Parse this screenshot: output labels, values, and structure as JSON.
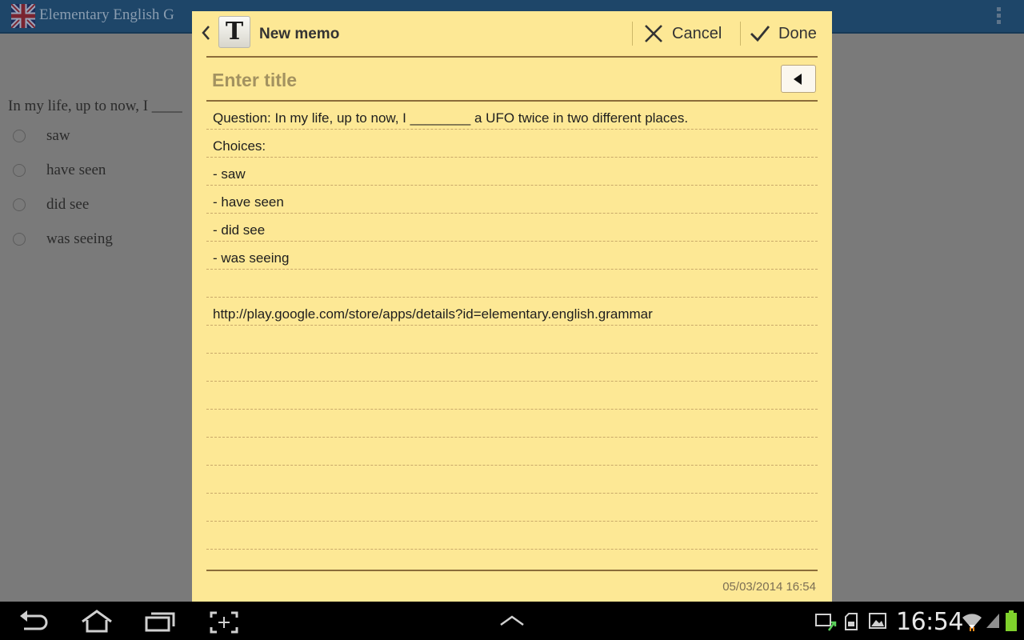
{
  "background_app": {
    "title": "Elementary English G",
    "question": "In my life, up to now, I ____",
    "choices": [
      {
        "label": "saw"
      },
      {
        "label": "have seen"
      },
      {
        "label": "did see"
      },
      {
        "label": "was seeing"
      }
    ]
  },
  "memo": {
    "header": {
      "title": "New memo",
      "app_icon": "text-memo-icon",
      "cancel_label": "Cancel",
      "done_label": "Done"
    },
    "title_field": {
      "placeholder": "Enter title",
      "value": ""
    },
    "lines": [
      "Question: In my life, up to now, I ________ a UFO twice in two different places.",
      "Choices:",
      "- saw",
      "- have seen",
      "- did see",
      "- was seeing",
      "",
      "http://play.google.com/store/apps/details?id=elementary.english.grammar",
      "",
      "",
      "",
      "",
      "",
      "",
      "",
      "",
      ""
    ],
    "timestamp": "05/03/2014 16:54"
  },
  "system_bar": {
    "clock": "16:54",
    "nav_icons": [
      "back-icon",
      "home-icon",
      "recent-apps-icon",
      "screenshot-icon",
      "menu-up-icon"
    ],
    "status_icons": [
      "usb-transfer-icon",
      "sd-card-icon",
      "gallery-icon",
      "wifi-icon",
      "signal-icon",
      "battery-icon"
    ]
  },
  "colors": {
    "memo_background": "#fde895",
    "rule": "#8b6d3a",
    "action_bar": "#1e4669"
  }
}
